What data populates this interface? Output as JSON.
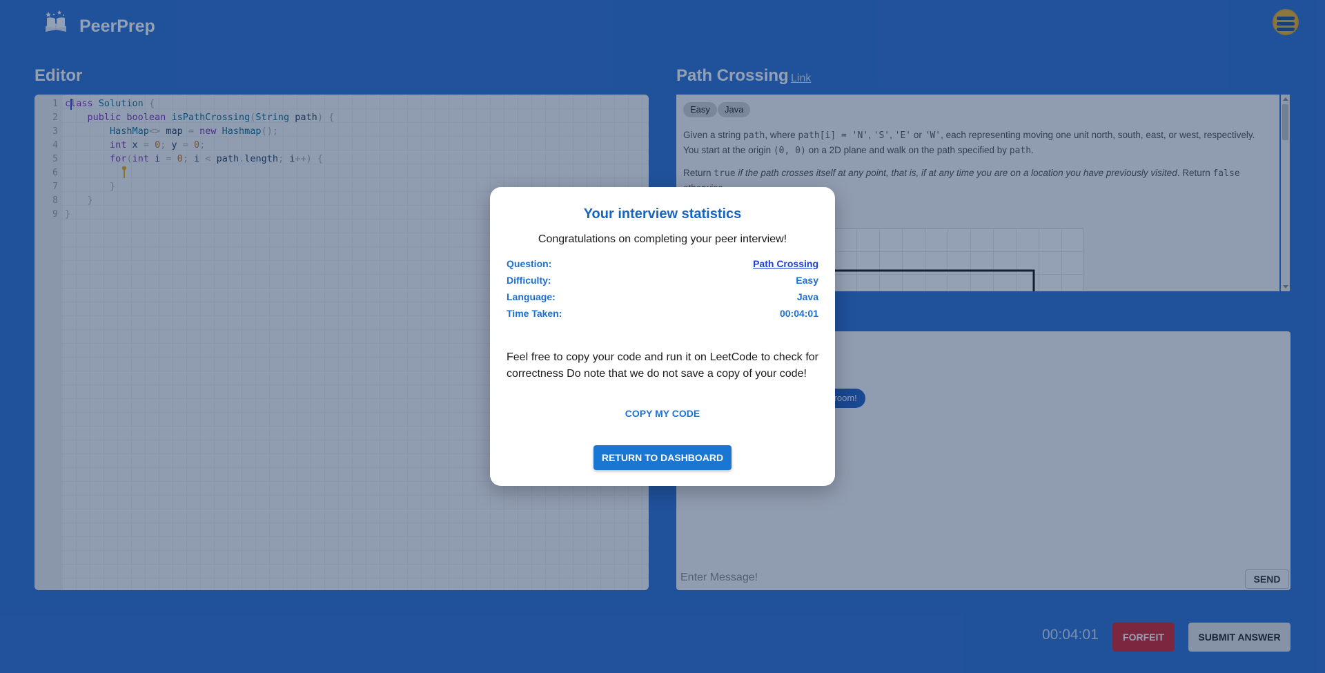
{
  "header": {
    "brand": "PeerPrep",
    "logo_icon": "book-stars-icon",
    "avatar_icon": "avatar-icon"
  },
  "editor": {
    "title": "Editor",
    "line_numbers": [
      "1",
      "2",
      "3",
      "4",
      "5",
      "6",
      "7",
      "8",
      "9"
    ]
  },
  "question": {
    "title": "Path Crossing",
    "link_label": "Link",
    "tags": [
      "Easy",
      "Java"
    ]
  },
  "chat": {
    "system_message": "d the room!",
    "input_placeholder": "Enter Message!",
    "send_label": "SEND"
  },
  "footer": {
    "timer": "00:04:01",
    "forfeit_label": "FORFEIT",
    "submit_label": "SUBMIT ANSWER"
  },
  "modal": {
    "title": "Your interview statistics",
    "subtitle": "Congratulations on completing your peer interview!",
    "stats": [
      {
        "label": "Question:",
        "value": "Path Crossing"
      },
      {
        "label": "Difficulty:",
        "value": "Easy"
      },
      {
        "label": "Language:",
        "value": "Java"
      },
      {
        "label": "Time Taken:",
        "value": "00:04:01"
      }
    ],
    "note": "Feel free to copy your code and run it on LeetCode to check for correctness Do note that we do not save a copy of your code!",
    "copy_label": "COPY MY CODE",
    "return_label": "RETURN TO DASHBOARD"
  },
  "colors": {
    "page_bg": "#2a6ed1",
    "accent": "#1976d2",
    "forfeit": "#d02028"
  }
}
